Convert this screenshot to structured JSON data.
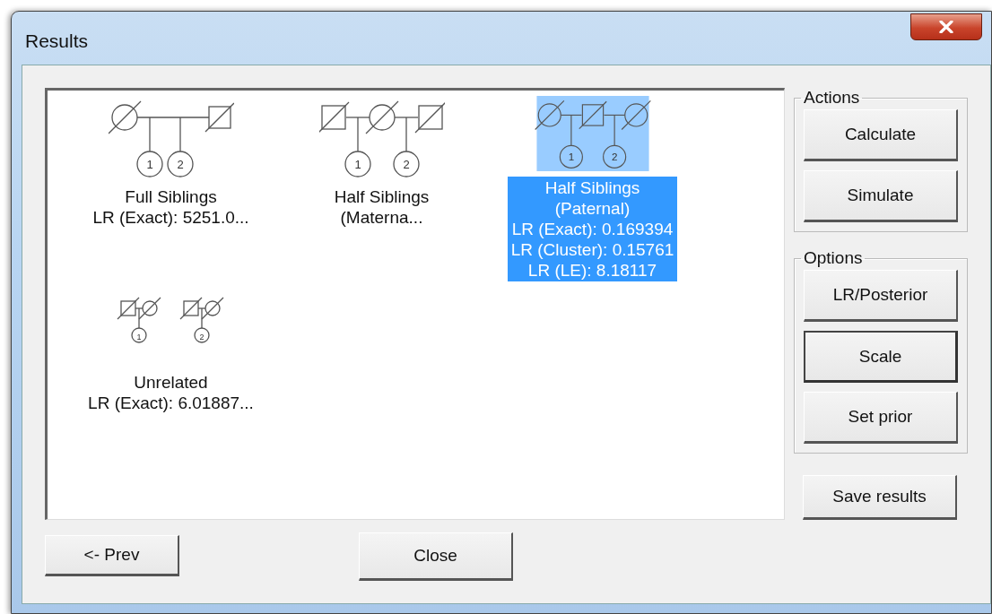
{
  "window": {
    "title": "Results"
  },
  "results": [
    {
      "kind": "full",
      "child_labels": [
        "1",
        "2"
      ],
      "lines": [
        "Full Siblings",
        "LR (Exact): 5251.0..."
      ],
      "selected": false
    },
    {
      "kind": "half_maternal",
      "child_labels": [
        "1",
        "2"
      ],
      "lines": [
        "Half Siblings",
        "(Materna..."
      ],
      "selected": false
    },
    {
      "kind": "half_paternal",
      "child_labels": [
        "1",
        "2"
      ],
      "lines": [
        "Half Siblings",
        "(Paternal)",
        "LR (Exact): 0.169394",
        "LR (Cluster): 0.15761",
        "LR (LE): 8.18117"
      ],
      "selected": true
    },
    {
      "kind": "unrelated",
      "child_labels": [
        "1",
        "2"
      ],
      "lines": [
        "Unrelated",
        "LR (Exact): 6.01887..."
      ],
      "selected": false
    }
  ],
  "groups": [
    {
      "title": "Actions",
      "buttons": [
        {
          "label": "Calculate",
          "default": false
        },
        {
          "label": "Simulate",
          "default": false
        }
      ]
    },
    {
      "title": "Options",
      "buttons": [
        {
          "label": "LR/Posterior",
          "default": false
        },
        {
          "label": "Scale",
          "default": true
        },
        {
          "label": "Set prior",
          "default": false
        }
      ]
    }
  ],
  "save_button": "Save results",
  "prev_button": "<- Prev",
  "close_button": "Close"
}
